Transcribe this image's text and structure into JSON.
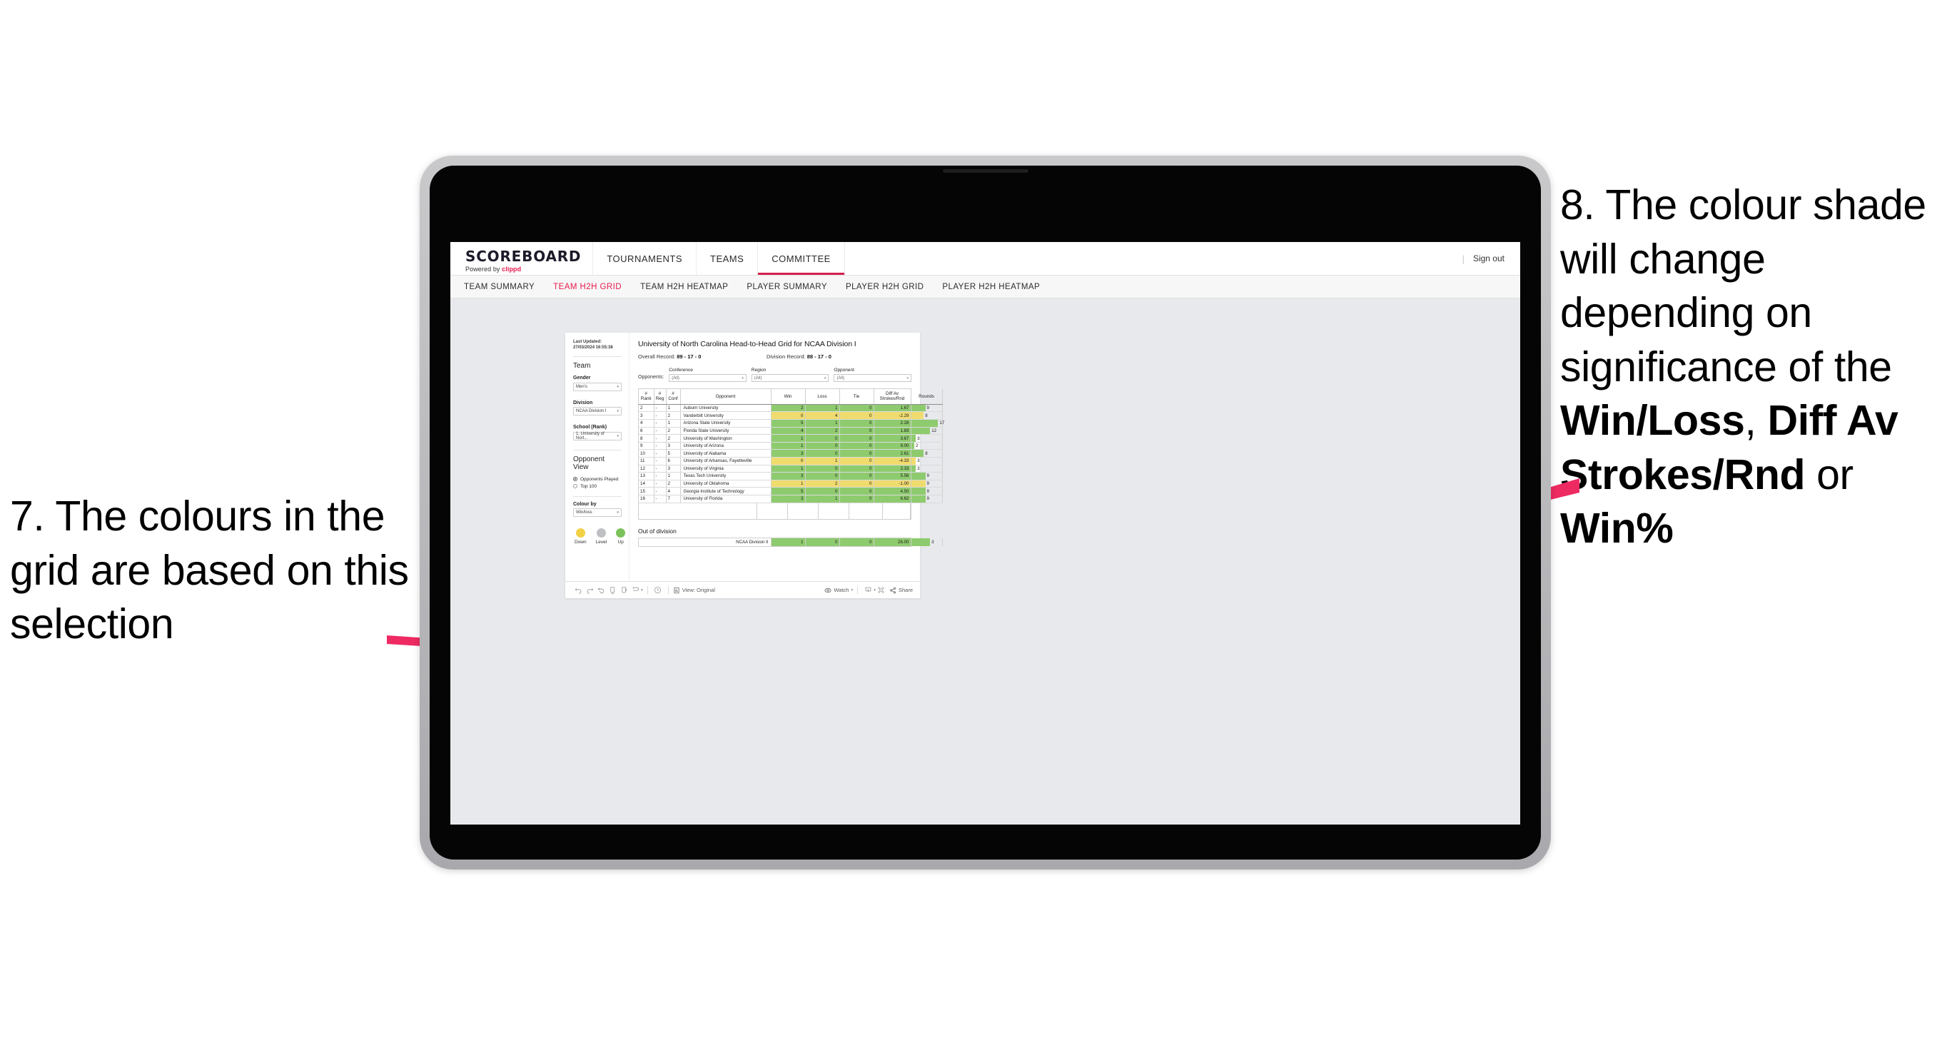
{
  "annotations": {
    "left": {
      "id": "7.",
      "text": "7. The colours in the grid are based on this selection"
    },
    "right": {
      "id": "8.",
      "lead": "8. The colour shade will change depending on significance of the ",
      "bold1": "Win/Loss",
      "mid1": ", ",
      "bold2": "Diff Av Strokes/Rnd",
      "mid2": " or ",
      "bold3": "Win%"
    },
    "arrow_color": "#ee2a63"
  },
  "app": {
    "brand_title": "SCOREBOARD",
    "brand_sub_prefix": "Powered by ",
    "brand_sub_name": "clippd",
    "topnav": [
      {
        "label": "TOURNAMENTS",
        "active": false
      },
      {
        "label": "TEAMS",
        "active": false
      },
      {
        "label": "COMMITTEE",
        "active": true
      }
    ],
    "signout_divider": "|",
    "signout": "Sign out",
    "subnav": [
      {
        "label": "TEAM SUMMARY",
        "active": false
      },
      {
        "label": "TEAM H2H GRID",
        "active": true
      },
      {
        "label": "TEAM H2H HEATMAP",
        "active": false
      },
      {
        "label": "PLAYER SUMMARY",
        "active": false
      },
      {
        "label": "PLAYER H2H GRID",
        "active": false
      },
      {
        "label": "PLAYER H2H HEATMAP",
        "active": false
      }
    ],
    "accent": "#e8194b"
  },
  "sidebar": {
    "last_updated": "Last Updated: 27/03/2024 16:55:38",
    "team_heading": "Team",
    "gender_label": "Gender",
    "gender_value": "Men's",
    "division_label": "Division",
    "division_value": "NCAA Division I",
    "school_label": "School (Rank)",
    "school_value": "1. University of Nort...",
    "opponent_view_heading": "Opponent View",
    "opponent_view_options": [
      {
        "label": "Opponents Played",
        "selected": true
      },
      {
        "label": "Top 100",
        "selected": false
      }
    ],
    "colour_by_label": "Colour by",
    "colour_by_value": "Win/loss",
    "legend": [
      {
        "label": "Down",
        "color": "#f2d147"
      },
      {
        "label": "Level",
        "color": "#bfc0c4"
      },
      {
        "label": "Up",
        "color": "#7cc25c"
      }
    ]
  },
  "main": {
    "title": "University of North Carolina Head-to-Head Grid for NCAA Division I",
    "overall_record_label": "Overall Record: ",
    "overall_record_value": "89 - 17 - 0",
    "division_record_label": "Division Record: ",
    "division_record_value": "88 - 17 - 0",
    "opponents_label": "Opponents:",
    "filters": [
      {
        "label": "Conference",
        "value": "(All)"
      },
      {
        "label": "Region",
        "value": "(All)"
      },
      {
        "label": "Opponent",
        "value": "(All)"
      }
    ],
    "out_of_division_heading": "Out of division"
  },
  "chart_data": {
    "type": "table",
    "title": "University of North Carolina Head-to-Head Grid for NCAA Division I",
    "columns": [
      "# Rank",
      "# Reg",
      "# Conf",
      "Opponent",
      "Win",
      "Loss",
      "Tie",
      "Diff Av Strokes/Rnd",
      "Rounds"
    ],
    "column_headers_multiline": [
      [
        "#",
        "Rank"
      ],
      [
        "#",
        "Reg"
      ],
      [
        "#",
        "Conf"
      ],
      [
        "Opponent"
      ],
      [
        "Win"
      ],
      [
        "Loss"
      ],
      [
        "Tie"
      ],
      [
        "Diff Av",
        "Strokes/Rnd"
      ],
      [
        "Rounds"
      ]
    ],
    "colors": {
      "up": "#8ecb6e",
      "down": "#f0dc6e",
      "level": "#bfc0c4",
      "rounds_bar_up": "#8ecb6e",
      "rounds_bar_down": "#f0dc6e"
    },
    "rounds_max": 17,
    "rows": [
      {
        "rank": "2",
        "reg": "-",
        "conf": "1",
        "opponent": "Auburn University",
        "win": "2",
        "loss": "1",
        "tie": "0",
        "diff": "1.67",
        "rounds": "9",
        "rounds_num": 9,
        "shade": "up"
      },
      {
        "rank": "3",
        "reg": "-",
        "conf": "2",
        "opponent": "Vanderbilt University",
        "win": "0",
        "loss": "4",
        "tie": "0",
        "diff": "-2.29",
        "rounds": "8",
        "rounds_num": 8,
        "shade": "down"
      },
      {
        "rank": "4",
        "reg": "-",
        "conf": "1",
        "opponent": "Arizona State University",
        "win": "5",
        "loss": "1",
        "tie": "0",
        "diff": "2.28",
        "rounds": "17",
        "rounds_num": 17,
        "shade": "up"
      },
      {
        "rank": "6",
        "reg": "-",
        "conf": "2",
        "opponent": "Florida State University",
        "win": "4",
        "loss": "2",
        "tie": "0",
        "diff": "1.83",
        "rounds": "12",
        "rounds_num": 12,
        "shade": "up"
      },
      {
        "rank": "8",
        "reg": "-",
        "conf": "2",
        "opponent": "University of Washington",
        "win": "1",
        "loss": "0",
        "tie": "0",
        "diff": "3.67",
        "rounds": "3",
        "rounds_num": 3,
        "shade": "up"
      },
      {
        "rank": "9",
        "reg": "-",
        "conf": "3",
        "opponent": "University of Arizona",
        "win": "1",
        "loss": "0",
        "tie": "0",
        "diff": "9.00",
        "rounds": "2",
        "rounds_num": 2,
        "shade": "up"
      },
      {
        "rank": "10",
        "reg": "-",
        "conf": "5",
        "opponent": "University of Alabama",
        "win": "3",
        "loss": "0",
        "tie": "0",
        "diff": "2.61",
        "rounds": "8",
        "rounds_num": 8,
        "shade": "up"
      },
      {
        "rank": "11",
        "reg": "-",
        "conf": "6",
        "opponent": "University of Arkansas, Fayetteville",
        "win": "0",
        "loss": "1",
        "tie": "0",
        "diff": "-4.33",
        "rounds": "3",
        "rounds_num": 3,
        "shade": "down"
      },
      {
        "rank": "12",
        "reg": "-",
        "conf": "3",
        "opponent": "University of Virginia",
        "win": "1",
        "loss": "0",
        "tie": "0",
        "diff": "2.33",
        "rounds": "3",
        "rounds_num": 3,
        "shade": "up"
      },
      {
        "rank": "13",
        "reg": "-",
        "conf": "1",
        "opponent": "Texas Tech University",
        "win": "3",
        "loss": "0",
        "tie": "0",
        "diff": "5.56",
        "rounds": "9",
        "rounds_num": 9,
        "shade": "up"
      },
      {
        "rank": "14",
        "reg": "-",
        "conf": "2",
        "opponent": "University of Oklahoma",
        "win": "1",
        "loss": "2",
        "tie": "0",
        "diff": "-1.00",
        "rounds": "9",
        "rounds_num": 9,
        "shade": "down"
      },
      {
        "rank": "15",
        "reg": "-",
        "conf": "4",
        "opponent": "Georgia Institute of Technology",
        "win": "5",
        "loss": "0",
        "tie": "0",
        "diff": "4.50",
        "rounds": "9",
        "rounds_num": 9,
        "shade": "up"
      },
      {
        "rank": "16",
        "reg": "-",
        "conf": "7",
        "opponent": "University of Florida",
        "win": "3",
        "loss": "1",
        "tie": "0",
        "diff": "6.62",
        "rounds": "9",
        "rounds_num": 9,
        "shade": "up"
      }
    ],
    "out_of_division": [
      {
        "opponent": "NCAA Division II",
        "win": "1",
        "loss": "0",
        "tie": "0",
        "diff": "26.00",
        "rounds": "3",
        "rounds_num": 3,
        "shade": "up"
      }
    ]
  },
  "toolbar": {
    "view_label": "View: Original",
    "watch_label": "Watch",
    "share_label": "Share"
  }
}
